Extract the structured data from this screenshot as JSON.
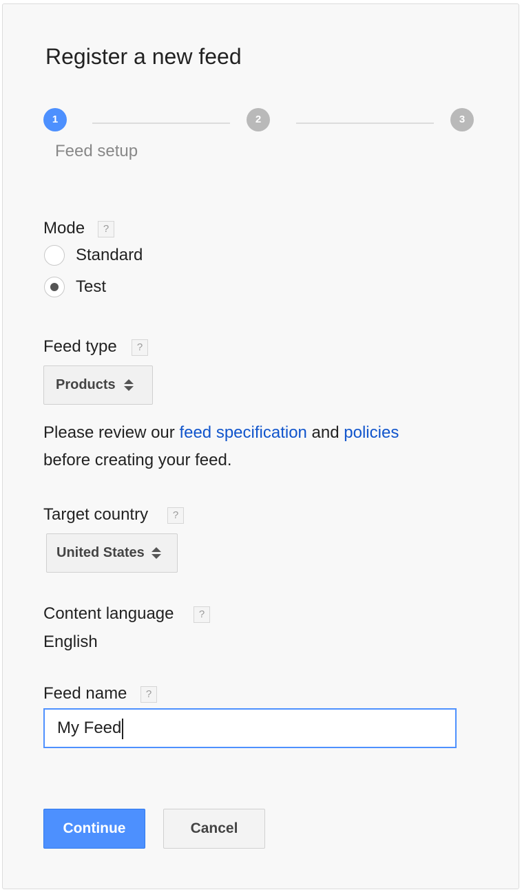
{
  "title": "Register a new feed",
  "steps": [
    {
      "number": "1",
      "state": "active"
    },
    {
      "number": "2",
      "state": "inactive"
    },
    {
      "number": "3",
      "state": "inactive"
    }
  ],
  "current_step_label": "Feed setup",
  "mode": {
    "label": "Mode",
    "help": "?",
    "options": [
      {
        "label": "Standard",
        "selected": false
      },
      {
        "label": "Test",
        "selected": true
      }
    ]
  },
  "feed_type": {
    "label": "Feed type",
    "help": "?",
    "selected": "Products"
  },
  "review": {
    "prefix": "Please review our ",
    "link1": "feed specification",
    "middle": " and ",
    "link2": "policies",
    "suffix": "before creating your feed."
  },
  "target_country": {
    "label": "Target country",
    "help": "?",
    "selected": "United States"
  },
  "content_language": {
    "label": "Content language",
    "help": "?",
    "value": "English"
  },
  "feed_name": {
    "label": "Feed name",
    "help": "?",
    "value": "My Feed"
  },
  "buttons": {
    "continue": "Continue",
    "cancel": "Cancel"
  },
  "colors": {
    "accent": "#4d90fe",
    "link": "#1155cc",
    "inactive_step": "#b9b9b9"
  }
}
